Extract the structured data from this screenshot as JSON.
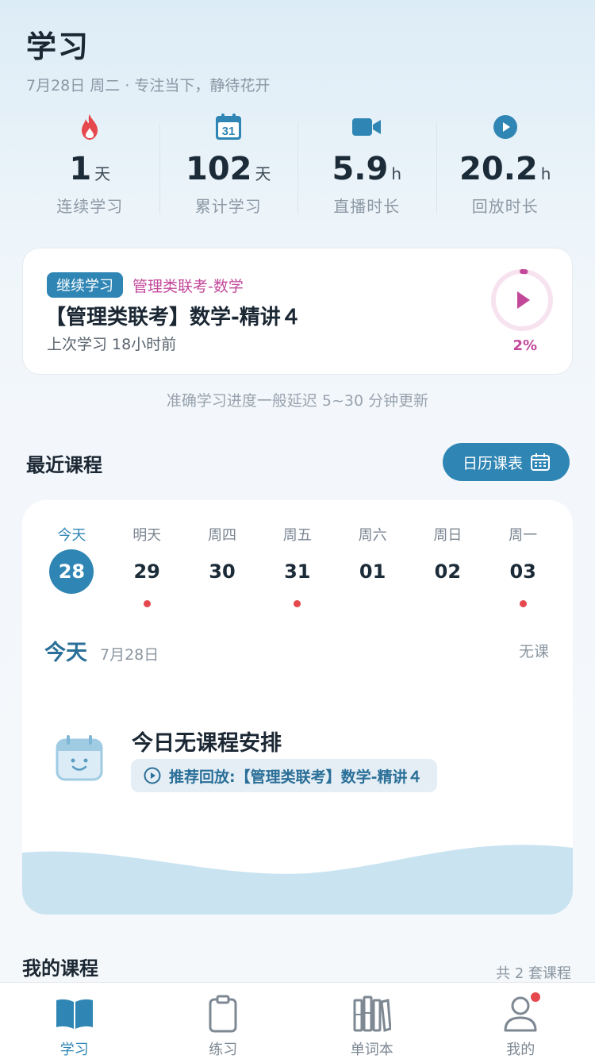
{
  "header": {
    "title": "学习",
    "subtitle": "7月28日 周二 · 专注当下，静待花开"
  },
  "stats": [
    {
      "icon": "flame-icon",
      "value": "1",
      "unit": "天",
      "label": "连续学习"
    },
    {
      "icon": "calendar-31-icon",
      "value": "102",
      "unit": "天",
      "label": "累计学习",
      "icon_text": "31"
    },
    {
      "icon": "video-camera-icon",
      "value": "5.9",
      "unit": "h",
      "label": "直播时长"
    },
    {
      "icon": "play-circle-icon",
      "value": "20.2",
      "unit": "h",
      "label": "回放时长"
    }
  ],
  "continue_card": {
    "badge": "继续学习",
    "subject": "管理类联考-数学",
    "title": "【管理类联考】数学-精讲４",
    "last_study": "上次学习 18小时前",
    "progress_percent": 2,
    "progress_label": "2%"
  },
  "delay_note": "准确学习进度一般延迟 5~30 分钟更新",
  "recent": {
    "title": "最近课程",
    "calendar_button": "日历课表"
  },
  "days": [
    {
      "name": "今天",
      "num": "28",
      "active": true,
      "has_class": false
    },
    {
      "name": "明天",
      "num": "29",
      "active": false,
      "has_class": true
    },
    {
      "name": "周四",
      "num": "30",
      "active": false,
      "has_class": false
    },
    {
      "name": "周五",
      "num": "31",
      "active": false,
      "has_class": true
    },
    {
      "name": "周六",
      "num": "01",
      "active": false,
      "has_class": false
    },
    {
      "name": "周日",
      "num": "02",
      "active": false,
      "has_class": false
    },
    {
      "name": "周一",
      "num": "03",
      "active": false,
      "has_class": true
    }
  ],
  "today": {
    "label": "今天",
    "date": "7月28日",
    "status": "无课",
    "empty_title": "今日无课程安排",
    "recommend": "推荐回放:【管理类联考】数学-精讲４"
  },
  "my_courses": {
    "title": "我的课程",
    "count": "共 2 套课程"
  },
  "tabbar": [
    {
      "label": "学习",
      "icon": "open-book-icon",
      "active": true
    },
    {
      "label": "练习",
      "icon": "clipboard-icon",
      "active": false
    },
    {
      "label": "单词本",
      "icon": "bookshelf-icon",
      "active": false
    },
    {
      "label": "我的",
      "icon": "user-icon",
      "active": false,
      "badge": true
    }
  ],
  "colors": {
    "accent": "#2f86b4",
    "pink": "#c3489a",
    "flame": "#e5484d"
  }
}
